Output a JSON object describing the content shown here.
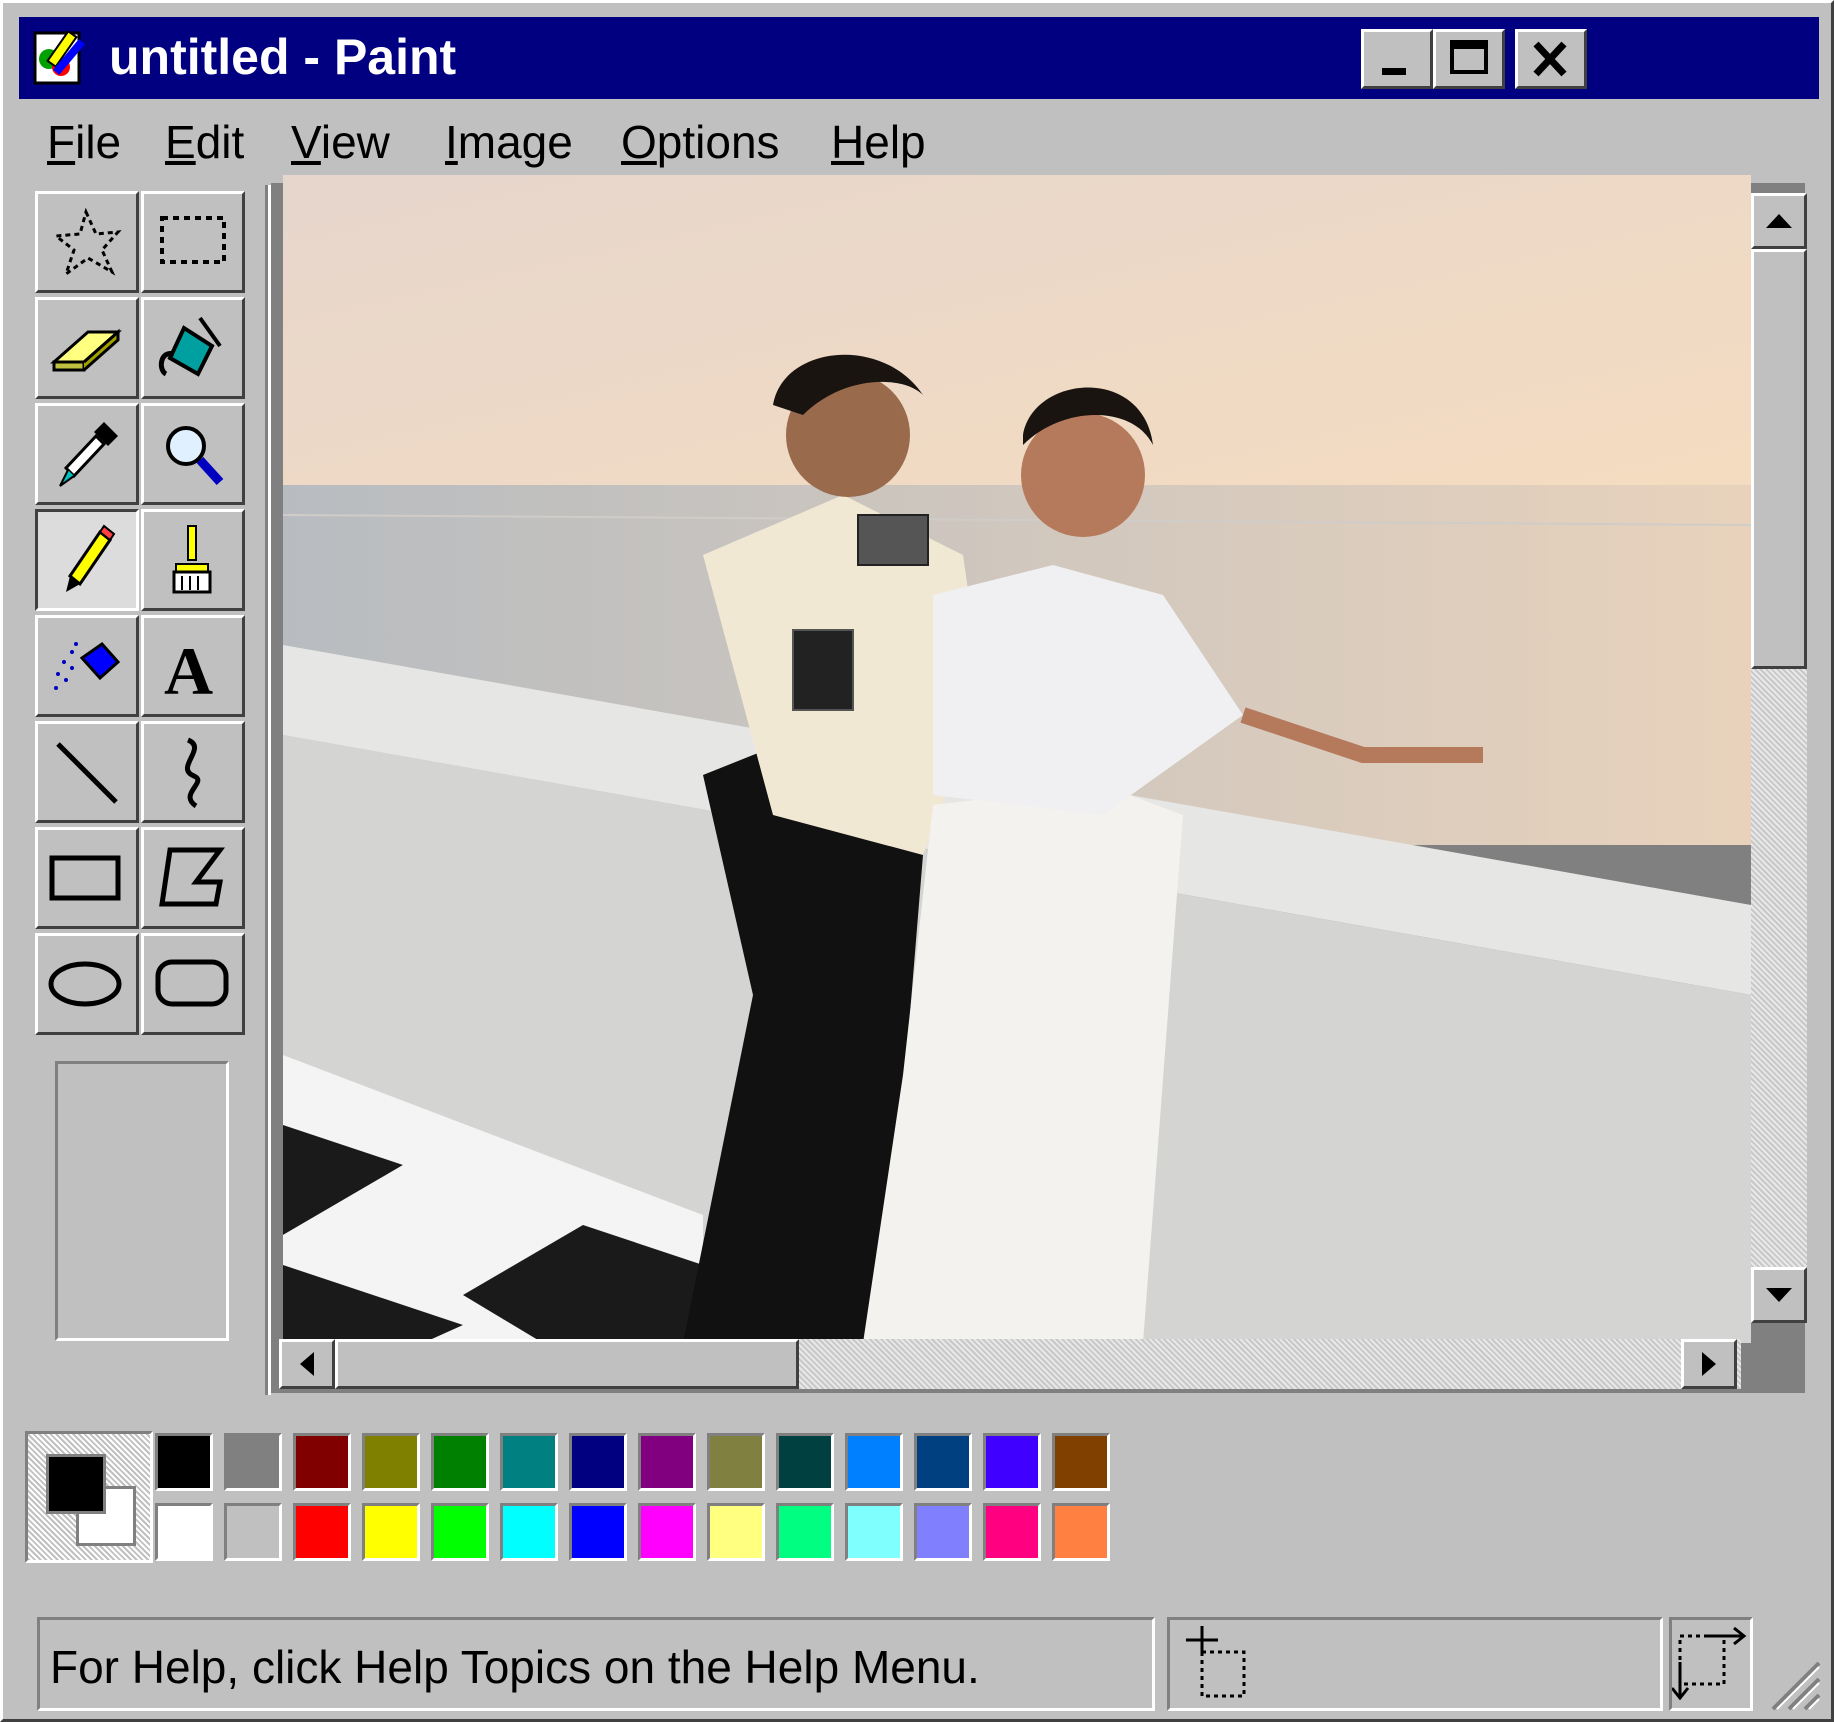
{
  "window": {
    "title": "untitled - Paint",
    "app_icon": "paint-app-icon",
    "controls": [
      "minimize-icon",
      "maximize-icon",
      "close-icon"
    ]
  },
  "menu": [
    "File",
    "Edit",
    "View",
    "Image",
    "Options",
    "Help"
  ],
  "tools": [
    {
      "name": "free-form-select",
      "icon": "free-form-select-icon"
    },
    {
      "name": "select",
      "icon": "rect-select-icon"
    },
    {
      "name": "eraser",
      "icon": "eraser-icon"
    },
    {
      "name": "fill-with-color",
      "icon": "paint-bucket-icon"
    },
    {
      "name": "pick-color",
      "icon": "eyedropper-icon"
    },
    {
      "name": "magnifier",
      "icon": "magnifier-icon"
    },
    {
      "name": "pencil",
      "icon": "pencil-icon",
      "active": true
    },
    {
      "name": "brush",
      "icon": "brush-icon"
    },
    {
      "name": "airbrush",
      "icon": "airbrush-icon"
    },
    {
      "name": "text",
      "icon": "text-icon"
    },
    {
      "name": "line",
      "icon": "line-icon"
    },
    {
      "name": "curve",
      "icon": "curve-icon"
    },
    {
      "name": "rectangle",
      "icon": "rectangle-icon"
    },
    {
      "name": "polygon",
      "icon": "polygon-icon"
    },
    {
      "name": "ellipse",
      "icon": "ellipse-icon"
    },
    {
      "name": "rounded-rectangle",
      "icon": "rounded-rectangle-icon"
    }
  ],
  "colors": {
    "foreground": "#000000",
    "background": "#ffffff",
    "palette_top": [
      "#000000",
      "#808080",
      "#800000",
      "#808000",
      "#008000",
      "#008080",
      "#000080",
      "#800080",
      "#808040",
      "#004040",
      "#0080ff",
      "#004080",
      "#4000ff",
      "#804000"
    ],
    "palette_bottom": [
      "#ffffff",
      "#c0c0c0",
      "#ff0000",
      "#ffff00",
      "#00ff00",
      "#00ffff",
      "#0000ff",
      "#ff00ff",
      "#ffff80",
      "#00ff80",
      "#80ffff",
      "#8080ff",
      "#ff0080",
      "#ff8040"
    ]
  },
  "status": {
    "help_text": "For Help, click Help Topics on the Help Menu."
  }
}
